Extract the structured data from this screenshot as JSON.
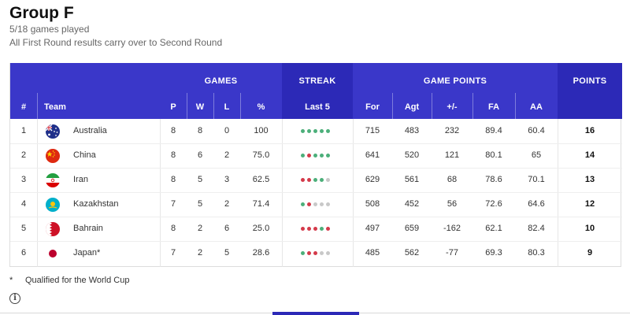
{
  "header": {
    "title": "Group F",
    "games_played": "5/18 games played",
    "note": "All First Round results carry over to Second Round"
  },
  "table": {
    "groups": {
      "games": "GAMES",
      "streak": "STREAK",
      "game_points": "GAME POINTS",
      "points": "POINTS"
    },
    "columns": {
      "rank": "#",
      "team": "Team",
      "p": "P",
      "w": "W",
      "l": "L",
      "pct": "%",
      "last5": "Last 5",
      "for": "For",
      "agt": "Agt",
      "diff": "+/-",
      "fa": "FA",
      "aa": "AA"
    },
    "rows": [
      {
        "rank": "1",
        "team": "Australia",
        "flag": "australia-flag",
        "p": "8",
        "w": "8",
        "l": "0",
        "pct": "100",
        "streak": [
          "W",
          "W",
          "W",
          "W",
          "W"
        ],
        "for": "715",
        "agt": "483",
        "diff": "232",
        "fa": "89.4",
        "aa": "60.4",
        "points": "16"
      },
      {
        "rank": "2",
        "team": "China",
        "flag": "china-flag",
        "p": "8",
        "w": "6",
        "l": "2",
        "pct": "75.0",
        "streak": [
          "W",
          "L",
          "W",
          "W",
          "W"
        ],
        "for": "641",
        "agt": "520",
        "diff": "121",
        "fa": "80.1",
        "aa": "65",
        "points": "14"
      },
      {
        "rank": "3",
        "team": "Iran",
        "flag": "iran-flag",
        "p": "8",
        "w": "5",
        "l": "3",
        "pct": "62.5",
        "streak": [
          "L",
          "L",
          "W",
          "W",
          "N"
        ],
        "for": "629",
        "agt": "561",
        "diff": "68",
        "fa": "78.6",
        "aa": "70.1",
        "points": "13"
      },
      {
        "rank": "4",
        "team": "Kazakhstan",
        "flag": "kazakhstan-flag",
        "p": "7",
        "w": "5",
        "l": "2",
        "pct": "71.4",
        "streak": [
          "W",
          "L",
          "N",
          "N",
          "N"
        ],
        "for": "508",
        "agt": "452",
        "diff": "56",
        "fa": "72.6",
        "aa": "64.6",
        "points": "12"
      },
      {
        "rank": "5",
        "team": "Bahrain",
        "flag": "bahrain-flag",
        "p": "8",
        "w": "2",
        "l": "6",
        "pct": "25.0",
        "streak": [
          "L",
          "L",
          "L",
          "W",
          "L"
        ],
        "for": "497",
        "agt": "659",
        "diff": "-162",
        "fa": "62.1",
        "aa": "82.4",
        "points": "10"
      },
      {
        "rank": "6",
        "team": "Japan*",
        "flag": "japan-flag",
        "p": "7",
        "w": "2",
        "l": "5",
        "pct": "28.6",
        "streak": [
          "W",
          "L",
          "L",
          "N",
          "N"
        ],
        "for": "485",
        "agt": "562",
        "diff": "-77",
        "fa": "69.3",
        "aa": "80.3",
        "points": "9"
      }
    ]
  },
  "footnote": {
    "marker": "*",
    "text": "Qualified for the World Cup"
  },
  "info_icon": "info-icon",
  "colors": {
    "header_bg": "#3a37c9",
    "header_dark": "#2c29b7",
    "win": "#4caf7a",
    "loss": "#d43a4a",
    "none": "#c8c8c8"
  }
}
